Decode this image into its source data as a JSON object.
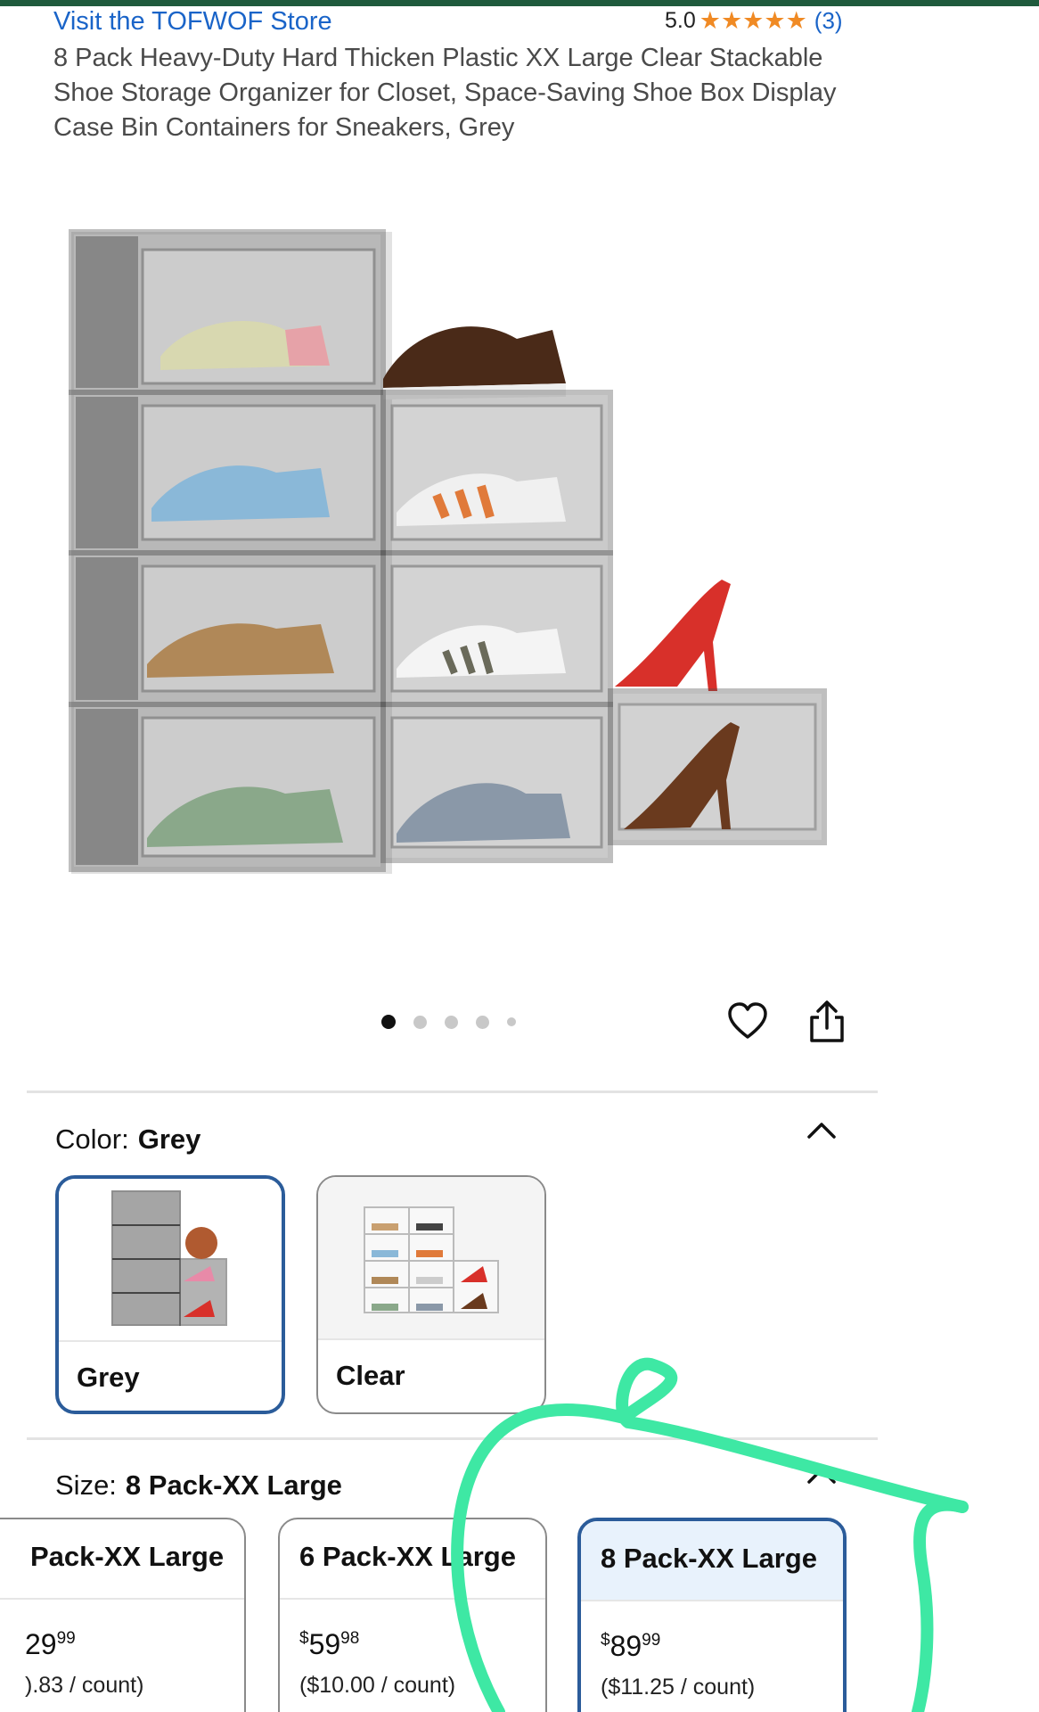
{
  "store": {
    "link_label": "Visit the TOFWOF Store"
  },
  "rating": {
    "value": "5.0",
    "stars": "★★★★★",
    "stars_count": 5,
    "count_label": "(3)"
  },
  "product": {
    "title": "8 Pack Heavy-Duty Hard Thicken Plastic XX Large Clear Stackable Shoe Storage Organizer for Closet, Space-Saving Shoe Box Display Case Bin Containers for Sneakers, Grey"
  },
  "gallery": {
    "image_count": 5,
    "active_index": 0
  },
  "color": {
    "label": "Color:",
    "selected_value": "Grey",
    "options": [
      {
        "label": "Grey",
        "selected": true
      },
      {
        "label": "Clear",
        "selected": false
      }
    ]
  },
  "size": {
    "label": "Size:",
    "selected_value": "8 Pack-XX Large",
    "options": [
      {
        "name": "Pack-XX Large",
        "price_main": "29",
        "price_cents": "99",
        "unit": ").83 / count)"
      },
      {
        "name": "6 Pack-XX Large",
        "price_dollar": "$",
        "price_main": "59",
        "price_cents": "98",
        "unit": "($10.00 / count)"
      },
      {
        "name": "8 Pack-XX Large",
        "price_dollar": "$",
        "price_main": "89",
        "price_cents": "99",
        "unit": "($11.25 / count)",
        "selected": true
      }
    ]
  },
  "colors": {
    "accent_blue": "#2b5c9a",
    "link_blue": "#1a64c8",
    "star_orange": "#f08a24",
    "annotation_green": "#3ee8a4",
    "top_bar_green": "#1f5a3c"
  }
}
